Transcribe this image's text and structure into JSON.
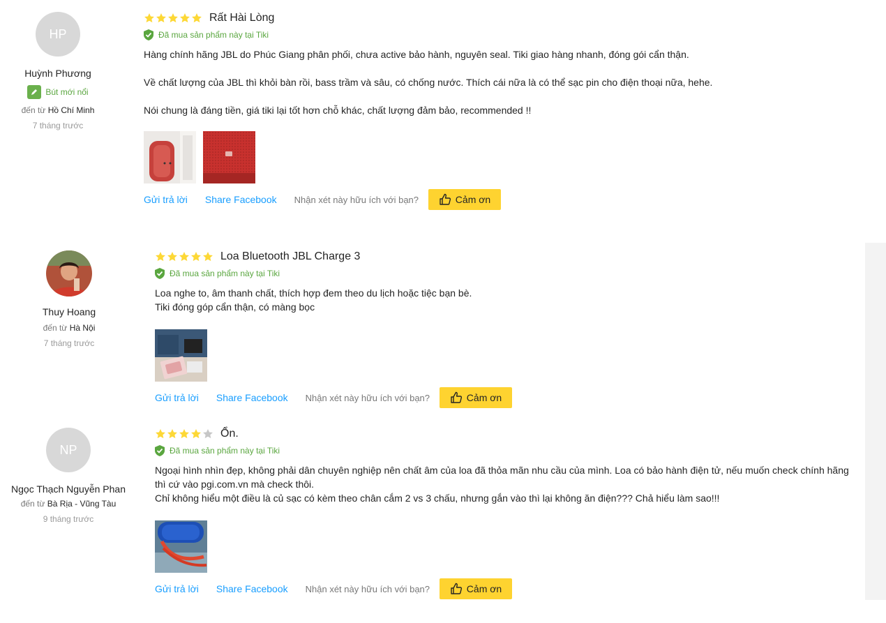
{
  "review_common": {
    "verified": "Đã mua sản phẩm này tại Tiki",
    "reply": "Gửi trả lời",
    "share": "Share Facebook",
    "helpful": "Nhận xét này hữu ích với bạn?",
    "thanks": "Cảm ơn",
    "from_prefix": "đến từ"
  },
  "reviews": [
    {
      "initials": "HP",
      "name": "Huỳnh Phương",
      "badge": "Bút mới nổi",
      "location": "Hồ Chí Minh",
      "time": "7 tháng trước",
      "rating": 5,
      "title": "Rất Hài Lòng",
      "content": [
        "Hàng chính hãng JBL do Phúc Giang phân phối, chưa active bảo hành, nguyên seal. Tiki giao hàng nhanh, đóng gói cẩn thận.",
        "Về chất lượng của JBL thì khỏi bàn rồi, bass trầm và sâu, có chống nước. Thích cái nữa là có thể sạc pin cho điện thoại nữa, hehe.",
        "Nói chung là đáng tiền, giá tiki lại tốt hơn chỗ khác, chất lượng đảm bảo, recommended !!"
      ]
    },
    {
      "name": "Thuy Hoang",
      "location": "Hà Nội",
      "time": "7 tháng trước",
      "rating": 5,
      "title": "Loa Bluetooth JBL Charge 3",
      "content_line1": "Loa nghe to, âm thanh chất, thích hợp đem theo du lịch hoặc tiệc bạn bè.",
      "content_line2": "Tiki đóng góp cẩn thận, có màng bọc"
    },
    {
      "initials": "NP",
      "name": "Ngọc Thạch Nguyễn Phan",
      "location": "Bà Rịa - Vũng Tàu",
      "time": "9 tháng trước",
      "rating": 4,
      "title": "Ổn.",
      "content_line1": "Ngoại hình nhìn đẹp, không phải dân chuyên nghiệp nên chất âm của loa đã thỏa mãn nhu cầu của mình. Loa có bảo hành điện tử, nếu muốn check chính hãng thì cứ vào pgi.com.vn mà check thôi.",
      "content_line2": "Chỉ không hiểu một điều là củ sạc có kèm theo chân cắm 2 vs 3 chấu, nhưng gắn vào thì lại không ăn điện??? Chả hiểu làm sao!!!"
    }
  ],
  "colors": {
    "star_on": "#fdd836",
    "star_off": "#c7c7c7",
    "link": "#189eff",
    "thanks_bg": "#fed330",
    "verified": "#5aa63f"
  }
}
